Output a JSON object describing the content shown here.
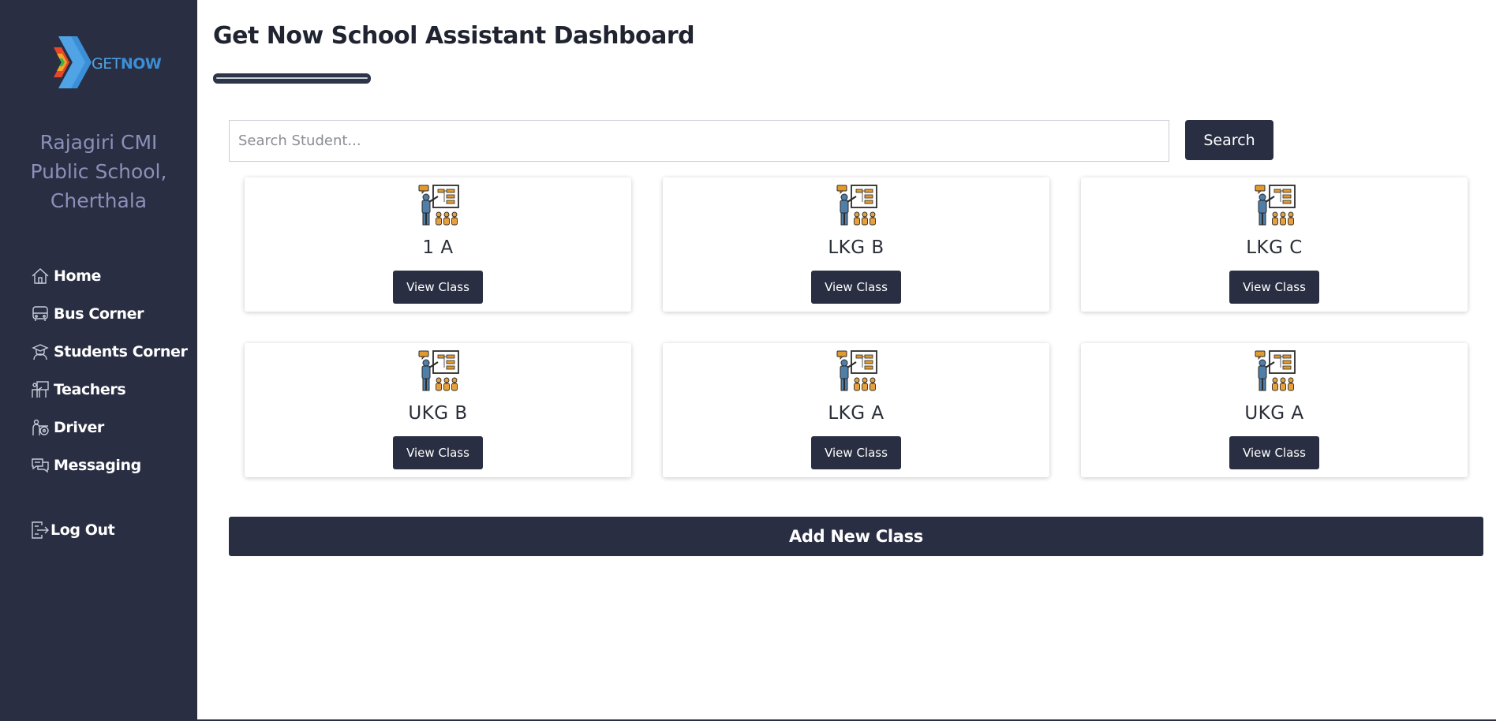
{
  "sidebar": {
    "logo_get": "GET",
    "logo_now": "NOW",
    "school_name": "Rajagiri CMI Public School, Cherthala",
    "nav": [
      {
        "label": "Home",
        "icon": "home-icon"
      },
      {
        "label": "Bus Corner",
        "icon": "bus-icon"
      },
      {
        "label": "Students Corner",
        "icon": "student-icon"
      },
      {
        "label": "Teachers",
        "icon": "teacher-icon"
      },
      {
        "label": "Driver",
        "icon": "driver-icon"
      },
      {
        "label": "Messaging",
        "icon": "chat-icon"
      }
    ],
    "logout": {
      "label": "Log Out",
      "icon": "logout-icon"
    }
  },
  "main": {
    "title": "Get Now School Assistant Dashboard",
    "search": {
      "placeholder": "Search Student...",
      "value": "",
      "button": "Search"
    },
    "classes": [
      {
        "name": "1 A",
        "button": "View Class"
      },
      {
        "name": "LKG B",
        "button": "View Class"
      },
      {
        "name": "LKG C",
        "button": "View Class"
      },
      {
        "name": "UKG B",
        "button": "View Class"
      },
      {
        "name": "LKG A",
        "button": "View Class"
      },
      {
        "name": "UKG A",
        "button": "View Class"
      }
    ],
    "add_button": "Add New Class"
  },
  "colors": {
    "sidebar_bg": "#292e42",
    "button_bg": "#292e42",
    "school_name": "#8b90b8",
    "logo_blue": "#3b8fd6"
  }
}
